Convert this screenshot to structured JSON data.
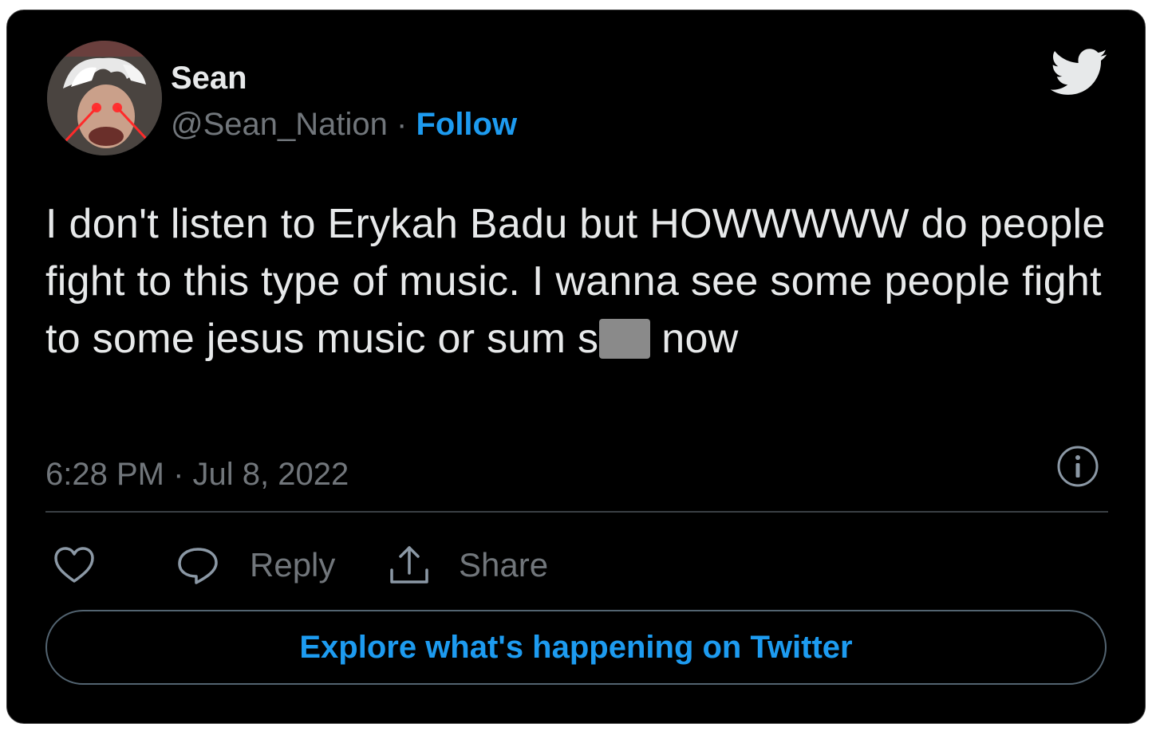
{
  "author": {
    "display_name": "Sean",
    "handle": "@Sean_Nation",
    "separator": " · ",
    "follow_label": "Follow"
  },
  "tweet": {
    "text_main": "I don't listen to Erykah Badu but HOWWWWW do people fight to this type of music. I wanna see some people fight to some jesus music or sum ",
    "text_censored_prefix": "s",
    "text_tail": "now",
    "timestamp": "6:28 PM · Jul 8, 2022"
  },
  "actions": {
    "like_icon": "heart-icon",
    "reply_icon": "speech-bubble-icon",
    "reply_label": "Reply",
    "share_icon": "upload-icon",
    "share_label": "Share"
  },
  "cta": {
    "explore_label": "Explore what's happening on Twitter"
  },
  "icons": {
    "brand": "twitter-bird-icon",
    "info": "info-icon"
  },
  "colors": {
    "background": "#000000",
    "text": "#e7e9ea",
    "muted": "#71767b",
    "accent": "#1d9bf0",
    "brand_bird": "#e7e9ea"
  }
}
